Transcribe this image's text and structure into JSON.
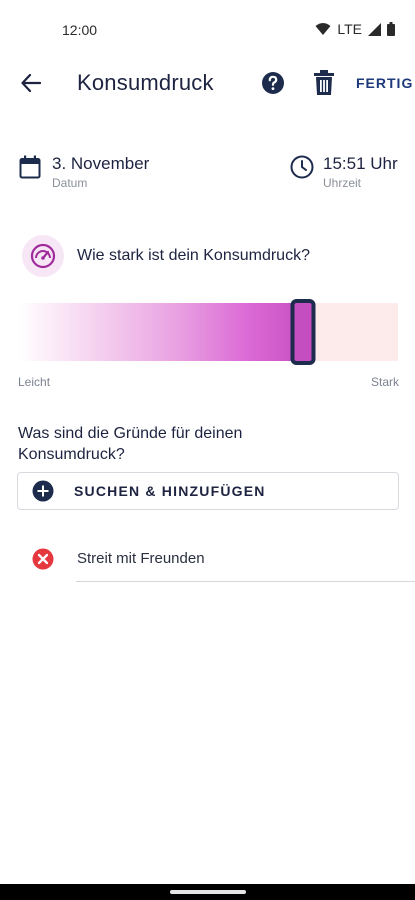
{
  "status_bar": {
    "time": "12:00",
    "network": "LTE"
  },
  "header": {
    "title": "Konsumdruck",
    "done_label": "FERTIG"
  },
  "datetime": {
    "date_value": "3. November",
    "date_label": "Datum",
    "time_value": "15:51 Uhr",
    "time_label": "Uhrzeit"
  },
  "intensity": {
    "question": "Wie stark ist dein Konsumdruck?",
    "level_fraction": 0.75,
    "low_label": "Leicht",
    "high_label": "Stark"
  },
  "reasons": {
    "question": "Was sind die Gründe für deinen Konsumdruck?",
    "add_button_label": "SUCHEN & HINZUFÜGEN",
    "items": [
      {
        "label": "Streit mit Freunden"
      }
    ]
  },
  "colors": {
    "primary": "#1d2c4d",
    "accent": "#c44ec0",
    "remove": "#e5393f"
  },
  "icons": [
    "back-arrow-icon",
    "help-icon",
    "trash-icon",
    "calendar-icon",
    "clock-icon",
    "gauge-icon",
    "add-circle-icon",
    "remove-circle-icon"
  ]
}
